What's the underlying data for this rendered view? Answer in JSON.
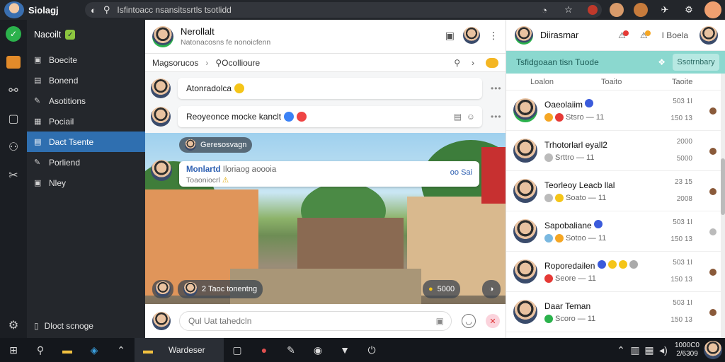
{
  "title_bar": {
    "app_name": "Siolagj",
    "search_text": "Isfintoacc nsansitssrtls tsotlidd"
  },
  "sidebar": {
    "icons": [
      "chat-icon",
      "calendar-icon",
      "link-icon",
      "square-icon",
      "user-icon",
      "tools-icon",
      "settings-icon"
    ]
  },
  "nav": {
    "header": "Nacoilt",
    "items": [
      {
        "label": "Boecite"
      },
      {
        "label": "Bonend"
      },
      {
        "label": "Asotitions"
      },
      {
        "label": "Pociail"
      },
      {
        "label": "Dact Tsente",
        "active": true
      },
      {
        "label": "Porliend"
      },
      {
        "label": "Nley"
      }
    ],
    "footer": "Dloct scnoge"
  },
  "chat": {
    "name": "Nerollalt",
    "subtitle": "Natonacosns fe nonoicfenn",
    "subbar_left": "Magsorucos",
    "subbar_right": "Ocollioure",
    "messages": [
      {
        "text": "Atonradolca"
      },
      {
        "text": "Reoyeonce mocke kanclt"
      }
    ],
    "photo_chip": "Geresosvagn",
    "card": {
      "name": "Monlartd",
      "name_extra": "Iloriaog aoooia",
      "sub": "Toaoniocrl",
      "right": "oo Sai"
    },
    "bottom_chip": "2 Taoc tonentng",
    "count_chip": "5000",
    "composer_placeholder": "Qul Uat tahedcln"
  },
  "right_panel": {
    "title": "Diirasrnar",
    "label": "I Boela",
    "teal_text": "Tsfidgoaan tisn Tuode",
    "teal_button": "Ssotrnbary",
    "columns": [
      "Loalon",
      "Toaito",
      "Taoite"
    ],
    "contacts": [
      {
        "name": "Oaeolaiim",
        "sub": "Stsro — 11",
        "t1": "503 1I",
        "t2": "150 13"
      },
      {
        "name": "Trhotorlarl eyall2",
        "sub": "Srttro — 11",
        "t1": "2000",
        "t2": "5000"
      },
      {
        "name": "Teorleoy Leacb llal",
        "sub": "Soato — 11",
        "t1": "23 15",
        "t2": "2008"
      },
      {
        "name": "Sapobaliane",
        "sub": "Sotoo — 11",
        "t1": "503 1I",
        "t2": "150 13"
      },
      {
        "name": "Roporedailen",
        "sub": "Seore — 11",
        "t1": "503 1I",
        "t2": "150 13"
      },
      {
        "name": "Daar Teman",
        "sub": "Scoro — 11",
        "t1": "503 1I",
        "t2": "150 13"
      }
    ]
  },
  "taskbar": {
    "active_label": "Wardeser",
    "clock_time": "1000C0",
    "clock_date": "2/6309"
  }
}
